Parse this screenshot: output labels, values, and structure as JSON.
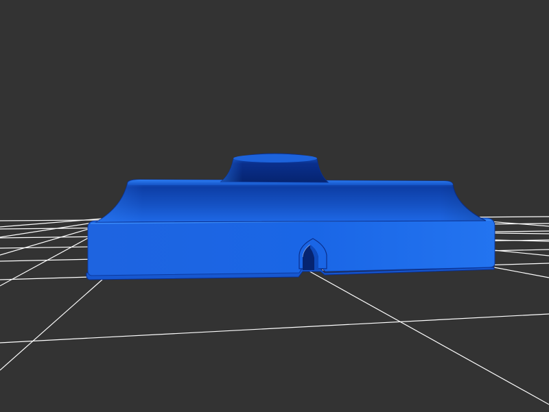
{
  "viewer": {
    "background_color": "#333333",
    "grid_color": "#ffffff",
    "model_color": "#1a66e6",
    "model_highlight": "#2a7ff5",
    "model_shadow": "#0a2f8c",
    "model_dark": "#062470"
  }
}
